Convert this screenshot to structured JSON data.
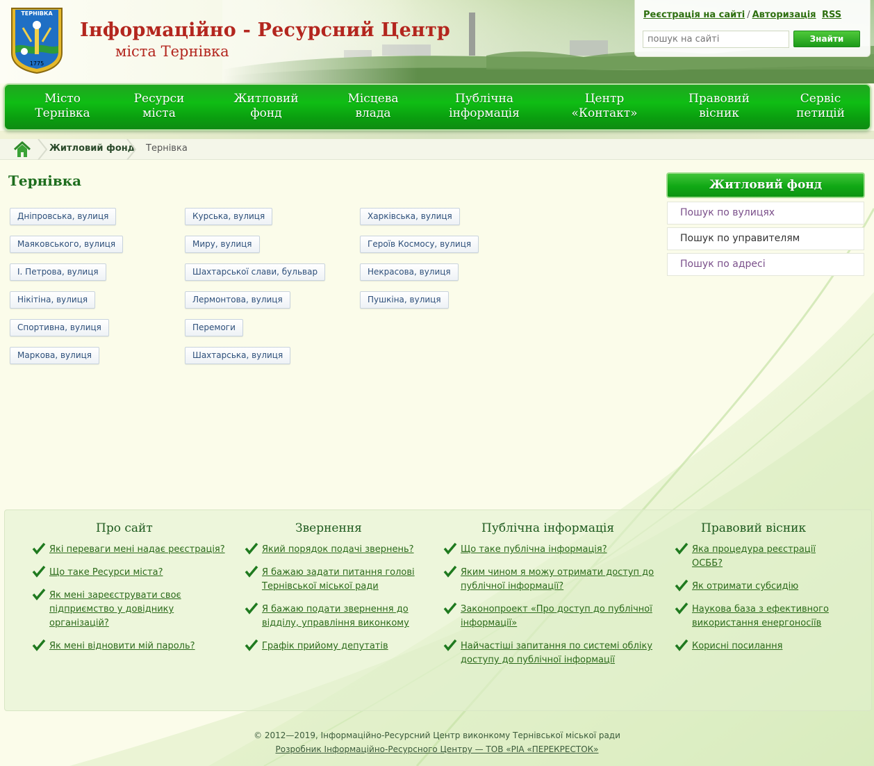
{
  "header": {
    "emblem_text": "ТЕРНІВКА",
    "emblem_year": "1775",
    "title": "Інформаційно - Ресурсний  Центр",
    "subtitle": "міста Тернівка",
    "register_link": "Реєстрація на сайті",
    "separator": "/",
    "login_link": "Авторизація",
    "rss": "RSS",
    "search_placeholder": "пошук на сайті",
    "search_button": "Знайти"
  },
  "nav": [
    {
      "label": "Місто\nТернівка"
    },
    {
      "label": "Ресурси\nміста"
    },
    {
      "label": "Житловий\nфонд"
    },
    {
      "label": "Місцева\nвлада"
    },
    {
      "label": "Публічна\nінформація"
    },
    {
      "label": "Центр\n«Контакт»"
    },
    {
      "label": "Правовий\nвісник"
    },
    {
      "label": "Сервіс\nпетицій"
    }
  ],
  "breadcrumb": {
    "items": [
      "Житловий фонд",
      "Тернівка"
    ]
  },
  "page": {
    "title": "Тернівка"
  },
  "streets": {
    "col1": [
      "Дніпровська, вулиця",
      "Маяковського, вулиця",
      "І. Петрова, вулиця",
      "Нікітіна, вулиця",
      "Спортивна, вулиця",
      "Маркова, вулиця"
    ],
    "col2": [
      "Курська, вулиця",
      "Миру, вулиця",
      "Шахтарської слави, бульвар",
      "Лермонтова, вулиця",
      "Перемоги",
      "Шахтарська, вулиця"
    ],
    "col3": [
      "Харківська, вулиця",
      "Героїв Космосу, вулиця",
      "Некрасова, вулиця",
      "Пушкіна, вулиця"
    ]
  },
  "sidebar": {
    "title": "Житловий фонд",
    "items": [
      "Пошук по вулицях",
      "Пошук по управителям",
      "Пошук по адресі"
    ]
  },
  "footer": {
    "columns": [
      {
        "title": "Про сайт",
        "links": [
          "Які переваги мені надає реєстрація?",
          "Що таке Ресурси міста?",
          "Як мені зареєструвати своє підприємство у довіднику організацій?",
          "Як мені відновити мій пароль?"
        ]
      },
      {
        "title": "Звернення",
        "links": [
          "Який порядок подачі звернень?",
          "Я бажаю задати питання голові Тернівської міської ради",
          "Я бажаю подати звернення до відділу, управління виконкому",
          "Графік прийому депутатів"
        ]
      },
      {
        "title": "Публічна інформація",
        "links": [
          "Що таке публічна інформація?",
          "Яким чином я можу отримати доступ до публічної інформації?",
          "Законопроект «Про доступ до публічної інформації»",
          "Найчастіші запитання по системі обліку доступу до публічної інформації"
        ]
      },
      {
        "title": "Правовий вісник",
        "links": [
          "Яка процедура реєстрації ОСББ?",
          "Як отримати субсидію",
          "Наукова база з ефективного використання енергоносіїв",
          "Корисні посилання"
        ]
      }
    ],
    "copyright": "© 2012—2019, Інформаційно-Ресурсний Центр виконкому Тернівської міської ради",
    "developer": "Розробник Інформаційно-Ресурсного Центру — ТОВ «РІА «ПЕРЕКРЕСТОК»"
  },
  "colors": {
    "brand_green": "#10a815",
    "title_red": "#b3261e",
    "link_green": "#2b6a1a"
  }
}
